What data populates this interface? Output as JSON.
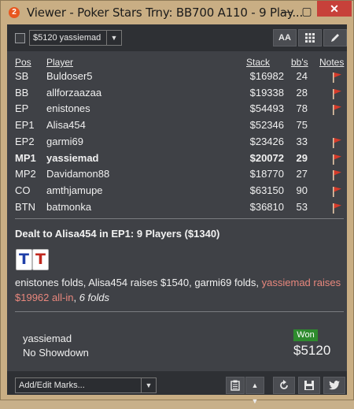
{
  "window": {
    "title": "Viewer - Poker Stars Trny: BB700 A110 - 9 Play...",
    "app_icon_glyph": "2",
    "close_glyph": "✕",
    "minimize_glyph": "—",
    "maximize_glyph": "▢"
  },
  "toolbar": {
    "player_select_value": "$5120 yassiemad",
    "font_button_label": "AA"
  },
  "table": {
    "headers": {
      "pos": "Pos",
      "player": "Player",
      "stack": "Stack",
      "bbs": "bb's",
      "notes": "Notes"
    },
    "rows": [
      {
        "pos": "SB",
        "player": "Buldoser5",
        "stack": "$16982",
        "bbs": "24",
        "flag": true,
        "bold": false
      },
      {
        "pos": "BB",
        "player": "allforzaazaa",
        "stack": "$19338",
        "bbs": "28",
        "flag": true,
        "bold": false
      },
      {
        "pos": "EP",
        "player": "enistones",
        "stack": "$54493",
        "bbs": "78",
        "flag": true,
        "bold": false
      },
      {
        "pos": "EP1",
        "player": "Alisa454",
        "stack": "$52346",
        "bbs": "75",
        "flag": false,
        "bold": false
      },
      {
        "pos": "EP2",
        "player": "garmi69",
        "stack": "$23426",
        "bbs": "33",
        "flag": true,
        "bold": false
      },
      {
        "pos": "MP1",
        "player": "yassiemad",
        "stack": "$20072",
        "bbs": "29",
        "flag": true,
        "bold": true
      },
      {
        "pos": "MP2",
        "player": "Davidamon88",
        "stack": "$18770",
        "bbs": "27",
        "flag": true,
        "bold": false
      },
      {
        "pos": "CO",
        "player": "amthjamupe",
        "stack": "$63150",
        "bbs": "90",
        "flag": true,
        "bold": false
      },
      {
        "pos": "BTN",
        "player": "batmonka",
        "stack": "$36810",
        "bbs": "53",
        "flag": true,
        "bold": false
      }
    ]
  },
  "hand": {
    "dealt_text": "Dealt to Alisa454 in EP1: 9 Players ($1340)",
    "cards": [
      {
        "rank": "T",
        "color": "#1f3fa8"
      },
      {
        "rank": "T",
        "color": "#c0281e"
      }
    ],
    "action": {
      "part1": "enistones folds, Alisa454 raises $1540, garmi69 folds, ",
      "part2": "yassiemad raises $19962 all-in",
      "part3": ", ",
      "part4": "6 folds"
    }
  },
  "result": {
    "player": "yassiemad",
    "showdown": "No Showdown",
    "badge": "Won",
    "amount": "$5120"
  },
  "bottom": {
    "marks_select": "Add/Edit Marks..."
  },
  "colors": {
    "panel_bg": "#3f4146",
    "highlight": "#e8877d",
    "won_badge": "#2e8b2e",
    "flag_red": "#d63a2a"
  }
}
